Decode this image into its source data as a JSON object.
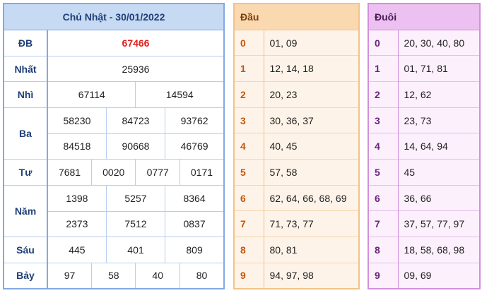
{
  "results": {
    "title": "Chủ Nhật - 30/01/2022",
    "rows": [
      {
        "label": "ĐB",
        "values": [
          "67466"
        ]
      },
      {
        "label": "Nhất",
        "values": [
          "25936"
        ]
      },
      {
        "label": "Nhì",
        "values": [
          "67114",
          "14594"
        ]
      },
      {
        "label": "Ba",
        "values": [
          "58230",
          "84723",
          "93762",
          "84518",
          "90668",
          "46769"
        ]
      },
      {
        "label": "Tư",
        "values": [
          "7681",
          "0020",
          "0777",
          "0171"
        ]
      },
      {
        "label": "Năm",
        "values": [
          "1398",
          "5257",
          "8364",
          "2373",
          "7512",
          "0837"
        ]
      },
      {
        "label": "Sáu",
        "values": [
          "445",
          "401",
          "809"
        ]
      },
      {
        "label": "Bảy",
        "values": [
          "97",
          "58",
          "40",
          "80"
        ]
      }
    ]
  },
  "dau": {
    "header": "Đầu",
    "rows": [
      {
        "num": "0",
        "values": "01, 09"
      },
      {
        "num": "1",
        "values": "12, 14, 18"
      },
      {
        "num": "2",
        "values": "20, 23"
      },
      {
        "num": "3",
        "values": "30, 36, 37"
      },
      {
        "num": "4",
        "values": "40, 45"
      },
      {
        "num": "5",
        "values": "57, 58"
      },
      {
        "num": "6",
        "values": "62, 64, 66, 68, 69"
      },
      {
        "num": "7",
        "values": "71, 73, 77"
      },
      {
        "num": "8",
        "values": "80, 81"
      },
      {
        "num": "9",
        "values": "94, 97, 98"
      }
    ]
  },
  "duoi": {
    "header": "Đuôi",
    "rows": [
      {
        "num": "0",
        "values": "20, 30, 40, 80"
      },
      {
        "num": "1",
        "values": "01, 71, 81"
      },
      {
        "num": "2",
        "values": "12, 62"
      },
      {
        "num": "3",
        "values": "23, 73"
      },
      {
        "num": "4",
        "values": "14, 64, 94"
      },
      {
        "num": "5",
        "values": "45"
      },
      {
        "num": "6",
        "values": "36, 66"
      },
      {
        "num": "7",
        "values": "37, 57, 77, 97"
      },
      {
        "num": "8",
        "values": "18, 58, 68, 98"
      },
      {
        "num": "9",
        "values": "09, 69"
      }
    ]
  },
  "colors": {
    "special_prize": "#e02020",
    "results_header": "#c7daf3",
    "dau_header": "#fad8b0",
    "duoi_header": "#ecc0f0"
  }
}
